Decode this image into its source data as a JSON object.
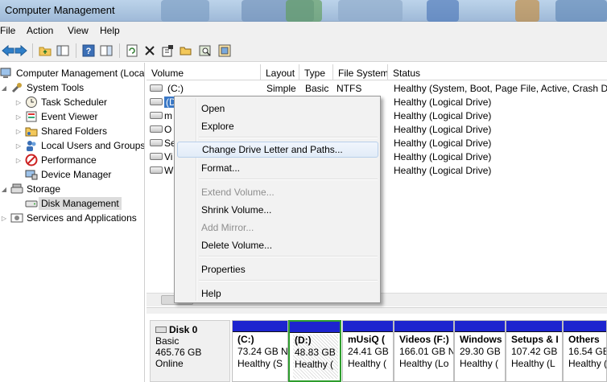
{
  "window": {
    "title": "Computer Management"
  },
  "menu": [
    "File",
    "Action",
    "View",
    "Help"
  ],
  "toolbar_icons": [
    "back-arrow-icon",
    "forward-arrow-icon",
    "up-folder-icon",
    "console-tree-icon",
    "help-icon",
    "show-hide-icon",
    "refresh-icon",
    "delete-icon",
    "properties-icon",
    "open-folder-icon",
    "search-disk-icon",
    "more-actions-icon"
  ],
  "tree": {
    "root": "Computer Management (Local",
    "items": [
      {
        "label": "System Tools",
        "icon": "tools-icon"
      },
      {
        "label": "Task Scheduler",
        "icon": "clock-icon"
      },
      {
        "label": "Event Viewer",
        "icon": "event-viewer-icon"
      },
      {
        "label": "Shared Folders",
        "icon": "shared-folder-icon"
      },
      {
        "label": "Local Users and Groups",
        "icon": "users-icon"
      },
      {
        "label": "Performance",
        "icon": "performance-icon"
      },
      {
        "label": "Device Manager",
        "icon": "device-manager-icon"
      },
      {
        "label": "Storage",
        "icon": "storage-icon"
      },
      {
        "label": "Disk Management",
        "icon": "disk-icon"
      },
      {
        "label": "Services and Applications",
        "icon": "services-icon"
      }
    ]
  },
  "volumes": {
    "columns": [
      "Volume",
      "Layout",
      "Type",
      "File System",
      "Status"
    ],
    "rows": [
      {
        "volume": "(C:)",
        "layout": "Simple",
        "type": "Basic",
        "fs": "NTFS",
        "status": "Healthy (System, Boot, Page File, Active, Crash Du"
      },
      {
        "volume": "(D:)",
        "layout": "",
        "type": "",
        "fs": "",
        "status": "Healthy (Logical Drive)"
      },
      {
        "volume": "mUsiQ",
        "layout": "",
        "type": "",
        "fs": "",
        "status": "Healthy (Logical Drive)"
      },
      {
        "volume": "Others",
        "layout": "",
        "type": "",
        "fs": "",
        "status": "Healthy (Logical Drive)"
      },
      {
        "volume": "Setups",
        "layout": "",
        "type": "",
        "fs": "",
        "status": "Healthy (Logical Drive)"
      },
      {
        "volume": "Videos",
        "layout": "",
        "type": "",
        "fs": "",
        "status": "Healthy (Logical Drive)"
      },
      {
        "volume": "Windows",
        "layout": "",
        "type": "",
        "fs": "",
        "status": "Healthy (Logical Drive)"
      }
    ],
    "visible_volume_text": [
      "(C:)",
      "(D",
      "m",
      "O",
      "Se",
      "Vi",
      "W"
    ]
  },
  "disk": {
    "name": "Disk 0",
    "type": "Basic",
    "size": "465.76 GB",
    "state": "Online",
    "partitions": [
      {
        "name": "(C:)",
        "size": "73.24 GB N",
        "status": "Healthy (S"
      },
      {
        "name": "(D:)",
        "size": "48.83 GB",
        "status": "Healthy ("
      },
      {
        "name": "mUsiQ  (",
        "size": "24.41 GB",
        "status": "Healthy ("
      },
      {
        "name": "Videos  (F:)",
        "size": "166.01 GB N",
        "status": "Healthy (Lo"
      },
      {
        "name": "Windows",
        "size": "29.30 GB",
        "status": "Healthy ("
      },
      {
        "name": "Setups & I",
        "size": "107.42 GB",
        "status": "Healthy (L"
      },
      {
        "name": "Others",
        "size": "16.54 GB",
        "status": "Healthy ("
      }
    ]
  },
  "context_menu": {
    "items": [
      {
        "label": "Open",
        "enabled": true
      },
      {
        "label": "Explore",
        "enabled": true
      },
      {
        "label": "Change Drive Letter and Paths...",
        "enabled": true,
        "highlighted": true
      },
      {
        "label": "Format...",
        "enabled": true
      },
      {
        "label": "Extend Volume...",
        "enabled": false
      },
      {
        "label": "Shrink Volume...",
        "enabled": true
      },
      {
        "label": "Add Mirror...",
        "enabled": false
      },
      {
        "label": "Delete Volume...",
        "enabled": true
      },
      {
        "label": "Properties",
        "enabled": true
      },
      {
        "label": "Help",
        "enabled": true
      }
    ]
  },
  "colors": {
    "partition_bar": "#1d24cf",
    "selection_border": "#2e9d2e",
    "highlight": "#e2ecf8"
  }
}
